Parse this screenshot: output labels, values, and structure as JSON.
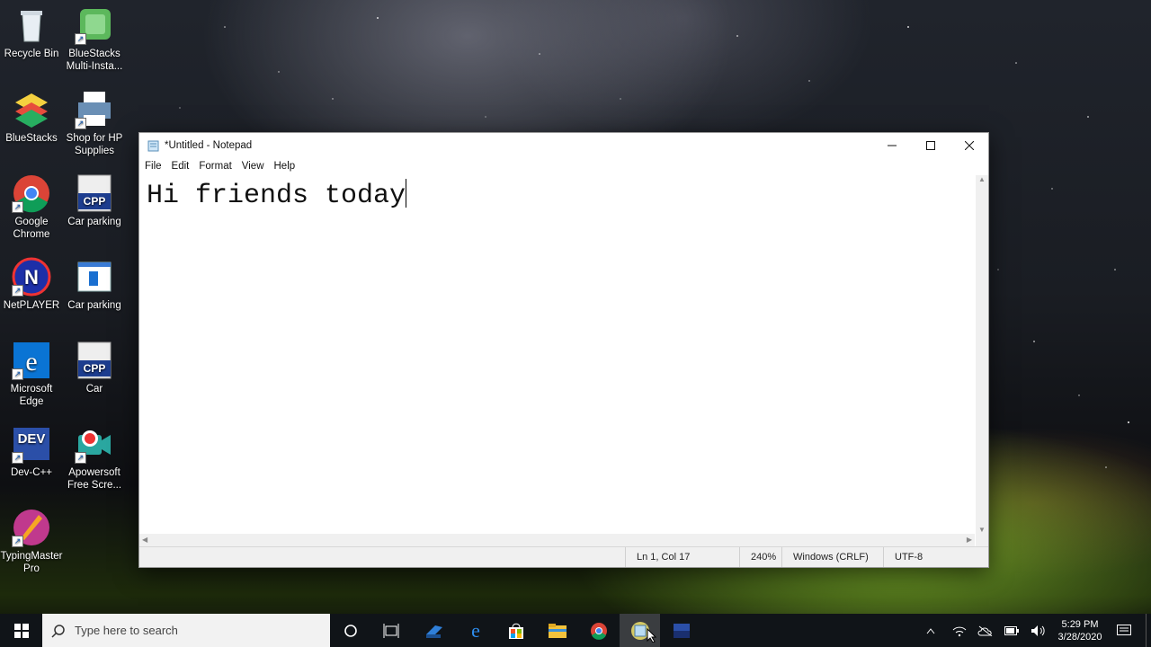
{
  "desktop": {
    "icons": [
      {
        "label": "Recycle Bin"
      },
      {
        "label": "BlueStacks Multi-Insta..."
      },
      {
        "label": "BlueStacks"
      },
      {
        "label": "Shop for HP Supplies"
      },
      {
        "label": "Google Chrome"
      },
      {
        "label": "Car parking"
      },
      {
        "label": "NetPLAYER"
      },
      {
        "label": "Car parking"
      },
      {
        "label": "Microsoft Edge"
      },
      {
        "label": "Car"
      },
      {
        "label": "Dev-C++"
      },
      {
        "label": "Apowersoft Free Scre..."
      },
      {
        "label": "TypingMaster Pro"
      }
    ],
    "cpp_badge": "CPP",
    "dev_badge": "DEV"
  },
  "notepad": {
    "title": "*Untitled - Notepad",
    "menu": [
      "File",
      "Edit",
      "Format",
      "View",
      "Help"
    ],
    "content": "Hi friends today",
    "status": {
      "position": "Ln 1, Col 17",
      "zoom": "240%",
      "line_endings": "Windows (CRLF)",
      "encoding": "UTF-8"
    }
  },
  "taskbar": {
    "search_placeholder": "Type here to search",
    "time": "5:29 PM",
    "date": "3/28/2020"
  },
  "colors": {
    "taskbar_bg": "#101418",
    "edge_blue": "#0a74d4",
    "explorer_yellow": "#f2c23c"
  }
}
